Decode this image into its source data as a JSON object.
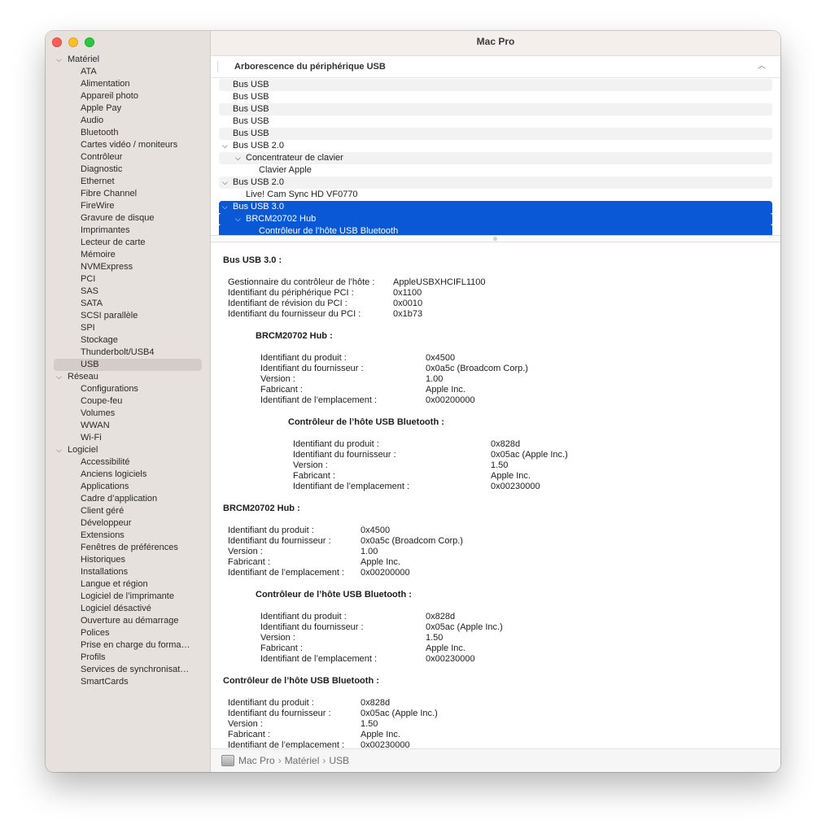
{
  "window": {
    "title": "Mac Pro"
  },
  "sidebar": {
    "groups": [
      {
        "label": "Matériel",
        "items": [
          "ATA",
          "Alimentation",
          "Appareil photo",
          "Apple Pay",
          "Audio",
          "Bluetooth",
          "Cartes vidéo / moniteurs",
          "Contrôleur",
          "Diagnostic",
          "Ethernet",
          "Fibre Channel",
          "FireWire",
          "Gravure de disque",
          "Imprimantes",
          "Lecteur de carte",
          "Mémoire",
          "NVMExpress",
          "PCI",
          "SAS",
          "SATA",
          "SCSI parallèle",
          "SPI",
          "Stockage",
          "Thunderbolt/USB4",
          "USB"
        ]
      },
      {
        "label": "Réseau",
        "items": [
          "Configurations",
          "Coupe-feu",
          "Volumes",
          "WWAN",
          "Wi-Fi"
        ]
      },
      {
        "label": "Logiciel",
        "items": [
          "Accessibilité",
          "Anciens logiciels",
          "Applications",
          "Cadre d’application",
          "Client géré",
          "Développeur",
          "Extensions",
          "Fenêtres de préférences",
          "Historiques",
          "Installations",
          "Langue et région",
          "Logiciel de l’imprimante",
          "Logiciel désactivé",
          "Ouverture au démarrage",
          "Polices",
          "Prise en charge du forma…",
          "Profils",
          "Services de synchronisat…",
          "SmartCards"
        ]
      }
    ],
    "selected": "USB"
  },
  "section": {
    "title": "Arborescence du périphérique USB",
    "collapse_icon": "chevron-up-icon"
  },
  "usb_tree": [
    {
      "label": "Bus USB",
      "level": 0,
      "expanded": null,
      "alt": true,
      "selected": false
    },
    {
      "label": "Bus USB",
      "level": 0,
      "expanded": null,
      "alt": false,
      "selected": false
    },
    {
      "label": "Bus USB",
      "level": 0,
      "expanded": null,
      "alt": true,
      "selected": false
    },
    {
      "label": "Bus USB",
      "level": 0,
      "expanded": null,
      "alt": false,
      "selected": false
    },
    {
      "label": "Bus USB",
      "level": 0,
      "expanded": null,
      "alt": true,
      "selected": false
    },
    {
      "label": "Bus USB 2.0",
      "level": 0,
      "expanded": true,
      "alt": false,
      "selected": false
    },
    {
      "label": "Concentrateur de clavier",
      "level": 1,
      "expanded": true,
      "alt": true,
      "selected": false
    },
    {
      "label": "Clavier Apple",
      "level": 2,
      "expanded": null,
      "alt": false,
      "selected": false
    },
    {
      "label": "Bus USB 2.0",
      "level": 0,
      "expanded": true,
      "alt": true,
      "selected": false
    },
    {
      "label": "Live! Cam Sync HD VF0770",
      "level": 1,
      "expanded": null,
      "alt": false,
      "selected": false
    },
    {
      "label": "Bus USB 3.0",
      "level": 0,
      "expanded": true,
      "alt": false,
      "selected": true
    },
    {
      "label": "BRCM20702 Hub",
      "level": 1,
      "expanded": true,
      "alt": false,
      "selected": true
    },
    {
      "label": "Contrôleur de l’hôte USB Bluetooth",
      "level": 2,
      "expanded": null,
      "alt": false,
      "selected": true
    }
  ],
  "details": {
    "bus": {
      "heading": "Bus USB 3.0 :",
      "rows": [
        {
          "label": "Gestionnaire du contrôleur de l’hôte :",
          "value": "AppleUSBXHCIFL1100"
        },
        {
          "label": "Identifiant du périphérique PCI :",
          "value": "0x1100"
        },
        {
          "label": "Identifiant de révision du PCI :",
          "value": "0x0010"
        },
        {
          "label": "Identifiant du fournisseur du PCI :",
          "value": "0x1b73"
        }
      ],
      "hub": {
        "heading": "BRCM20702 Hub :",
        "rows": [
          {
            "label": "Identifiant du produit :",
            "value": "0x4500"
          },
          {
            "label": "Identifiant du fournisseur :",
            "value": "0x0a5c  (Broadcom Corp.)"
          },
          {
            "label": "Version :",
            "value": "1.00"
          },
          {
            "label": "Fabricant :",
            "value": "Apple Inc."
          },
          {
            "label": "Identifiant de l’emplacement :",
            "value": "0x00200000"
          }
        ],
        "bt": {
          "heading": "Contrôleur de l’hôte USB Bluetooth :",
          "rows": [
            {
              "label": "Identifiant du produit :",
              "value": "0x828d"
            },
            {
              "label": "Identifiant du fournisseur :",
              "value": "0x05ac (Apple Inc.)"
            },
            {
              "label": "Version :",
              "value": "1.50"
            },
            {
              "label": "Fabricant :",
              "value": "Apple Inc."
            },
            {
              "label": "Identifiant de l’emplacement :",
              "value": "0x00230000"
            }
          ]
        }
      }
    },
    "hub2": {
      "heading": "BRCM20702 Hub :",
      "rows": [
        {
          "label": "Identifiant du produit :",
          "value": "0x4500"
        },
        {
          "label": "Identifiant du fournisseur :",
          "value": "0x0a5c  (Broadcom Corp.)"
        },
        {
          "label": "Version :",
          "value": "1.00"
        },
        {
          "label": "Fabricant :",
          "value": "Apple Inc."
        },
        {
          "label": "Identifiant de l’emplacement :",
          "value": "0x00200000"
        }
      ],
      "bt": {
        "heading": "Contrôleur de l’hôte USB Bluetooth :",
        "rows": [
          {
            "label": "Identifiant du produit :",
            "value": "0x828d"
          },
          {
            "label": "Identifiant du fournisseur :",
            "value": "0x05ac (Apple Inc.)"
          },
          {
            "label": "Version :",
            "value": "1.50"
          },
          {
            "label": "Fabricant :",
            "value": "Apple Inc."
          },
          {
            "label": "Identifiant de l’emplacement :",
            "value": "0x00230000"
          }
        ]
      }
    },
    "bt3": {
      "heading": "Contrôleur de l’hôte USB Bluetooth :",
      "rows": [
        {
          "label": "Identifiant du produit :",
          "value": "0x828d"
        },
        {
          "label": "Identifiant du fournisseur :",
          "value": "0x05ac (Apple Inc.)"
        },
        {
          "label": "Version :",
          "value": "1.50"
        },
        {
          "label": "Fabricant :",
          "value": "Apple Inc."
        },
        {
          "label": "Identifiant de l’emplacement :",
          "value": "0x00230000"
        }
      ]
    }
  },
  "pathbar": {
    "icon": "mac-pro-icon",
    "crumbs": [
      "Mac Pro",
      "Matériel",
      "USB"
    ],
    "separator": "›"
  }
}
